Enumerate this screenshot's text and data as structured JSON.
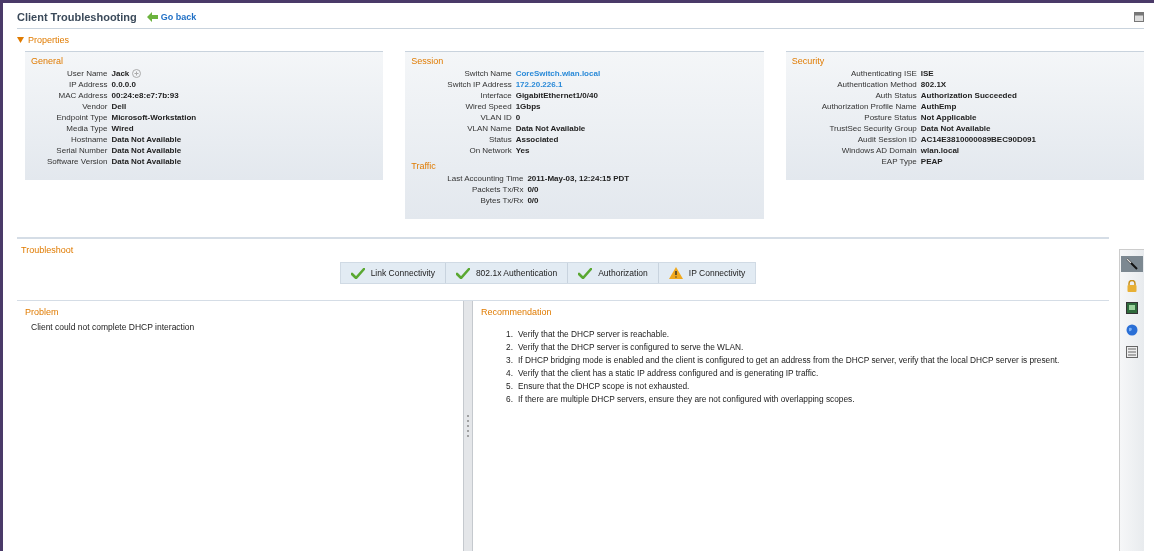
{
  "header": {
    "title": "Client Troubleshooting",
    "back_link": "Go back"
  },
  "properties": {
    "label": "Properties",
    "expanded": true,
    "panels": [
      {
        "sections": [
          {
            "title": "General",
            "fields": [
              {
                "label": "User Name",
                "value": "Jack",
                "link": false,
                "info": true
              },
              {
                "label": "IP Address",
                "value": "0.0.0.0",
                "link": false,
                "info": false
              },
              {
                "label": "MAC Address",
                "value": "00:24:e8:e7:7b:93",
                "link": false,
                "info": false
              },
              {
                "label": "Vendor",
                "value": "Dell",
                "link": false,
                "info": false
              },
              {
                "label": "Endpoint Type",
                "value": "Microsoft-Workstation",
                "link": false,
                "info": false
              },
              {
                "label": "Media Type",
                "value": "Wired",
                "link": false,
                "info": false
              },
              {
                "label": "Hostname",
                "value": "Data Not Available",
                "link": false,
                "info": false
              },
              {
                "label": "Serial Number",
                "value": "Data Not Available",
                "link": false,
                "info": false
              },
              {
                "label": "Software Version",
                "value": "Data Not Available",
                "link": false,
                "info": false
              }
            ]
          }
        ]
      },
      {
        "sections": [
          {
            "title": "Session",
            "fields": [
              {
                "label": "Switch Name",
                "value": "CoreSwitch.wlan.local",
                "link": true,
                "info": false
              },
              {
                "label": "Switch IP Address",
                "value": "172.20.226.1",
                "link": true,
                "info": false
              },
              {
                "label": "Interface",
                "value": "GigabitEthernet1/0/40",
                "link": false,
                "info": false
              },
              {
                "label": "Wired Speed",
                "value": "1Gbps",
                "link": false,
                "info": false
              },
              {
                "label": "VLAN ID",
                "value": "0",
                "link": false,
                "info": false
              },
              {
                "label": "VLAN Name",
                "value": "Data Not Available",
                "link": false,
                "info": false
              },
              {
                "label": "Status",
                "value": "Associated",
                "link": false,
                "info": false
              },
              {
                "label": "On Network",
                "value": "Yes",
                "link": false,
                "info": false
              }
            ]
          },
          {
            "title": "Traffic",
            "fields": [
              {
                "label": "Last Accounting Time",
                "value": "2011-May-03, 12:24:15 PDT",
                "link": false,
                "info": false
              },
              {
                "label": "Packets Tx/Rx",
                "value": "0/0",
                "link": false,
                "info": false
              },
              {
                "label": "Bytes Tx/Rx",
                "value": "0/0",
                "link": false,
                "info": false
              }
            ]
          }
        ]
      },
      {
        "sections": [
          {
            "title": "Security",
            "fields": [
              {
                "label": "Authenticating ISE",
                "value": "ISE",
                "link": false,
                "info": false
              },
              {
                "label": "Authentication Method",
                "value": "802.1X",
                "link": false,
                "info": false
              },
              {
                "label": "Auth Status",
                "value": "Authorization Succeeded",
                "link": false,
                "info": false
              },
              {
                "label": "Authorization Profile Name",
                "value": "AuthEmp",
                "link": false,
                "info": false
              },
              {
                "label": "Posture Status",
                "value": "Not Applicable",
                "link": false,
                "info": false
              },
              {
                "label": "TrustSec Security Group",
                "value": "Data Not Available",
                "link": false,
                "info": false
              },
              {
                "label": "Audit Session ID",
                "value": "AC14E3810000089BEC90D091",
                "link": false,
                "info": false
              },
              {
                "label": "Windows AD Domain",
                "value": "wlan.local",
                "link": false,
                "info": false
              },
              {
                "label": "EAP Type",
                "value": "PEAP",
                "link": false,
                "info": false
              }
            ]
          }
        ]
      }
    ]
  },
  "troubleshoot": {
    "title": "Troubleshoot",
    "steps": [
      {
        "label": "Link Connectivity",
        "kind": "success"
      },
      {
        "label": "802.1x Authentication",
        "kind": "success"
      },
      {
        "label": "Authorization",
        "kind": "success"
      },
      {
        "label": "IP Connectivity",
        "kind": "warning"
      }
    ],
    "problem": {
      "title": "Problem",
      "text": "Client could not complete DHCP interaction"
    },
    "recommendation": {
      "title": "Recommendation",
      "items": [
        {
          "number": "1.",
          "text": "Verify that the DHCP server is reachable."
        },
        {
          "number": "2.",
          "text": "Verify that the DHCP server is configured to serve the WLAN."
        },
        {
          "number": "3.",
          "text": "If DHCP bridging mode is enabled and the client is configured to get an address from the DHCP server, verify that the local DHCP server is present."
        },
        {
          "number": "4.",
          "text": "Verify that the client has a static IP address configured and is generating IP traffic."
        },
        {
          "number": "5.",
          "text": "Ensure that the DHCP scope is not exhausted."
        },
        {
          "number": "6.",
          "text": "If there are multiple DHCP servers, ensure they are not configured with overlapping scopes."
        }
      ]
    }
  },
  "side_tools": [
    {
      "kind": "tools",
      "selected": true
    },
    {
      "kind": "lock",
      "selected": false
    },
    {
      "kind": "monitor",
      "selected": false
    },
    {
      "kind": "globe",
      "selected": false
    },
    {
      "kind": "report",
      "selected": false
    }
  ]
}
